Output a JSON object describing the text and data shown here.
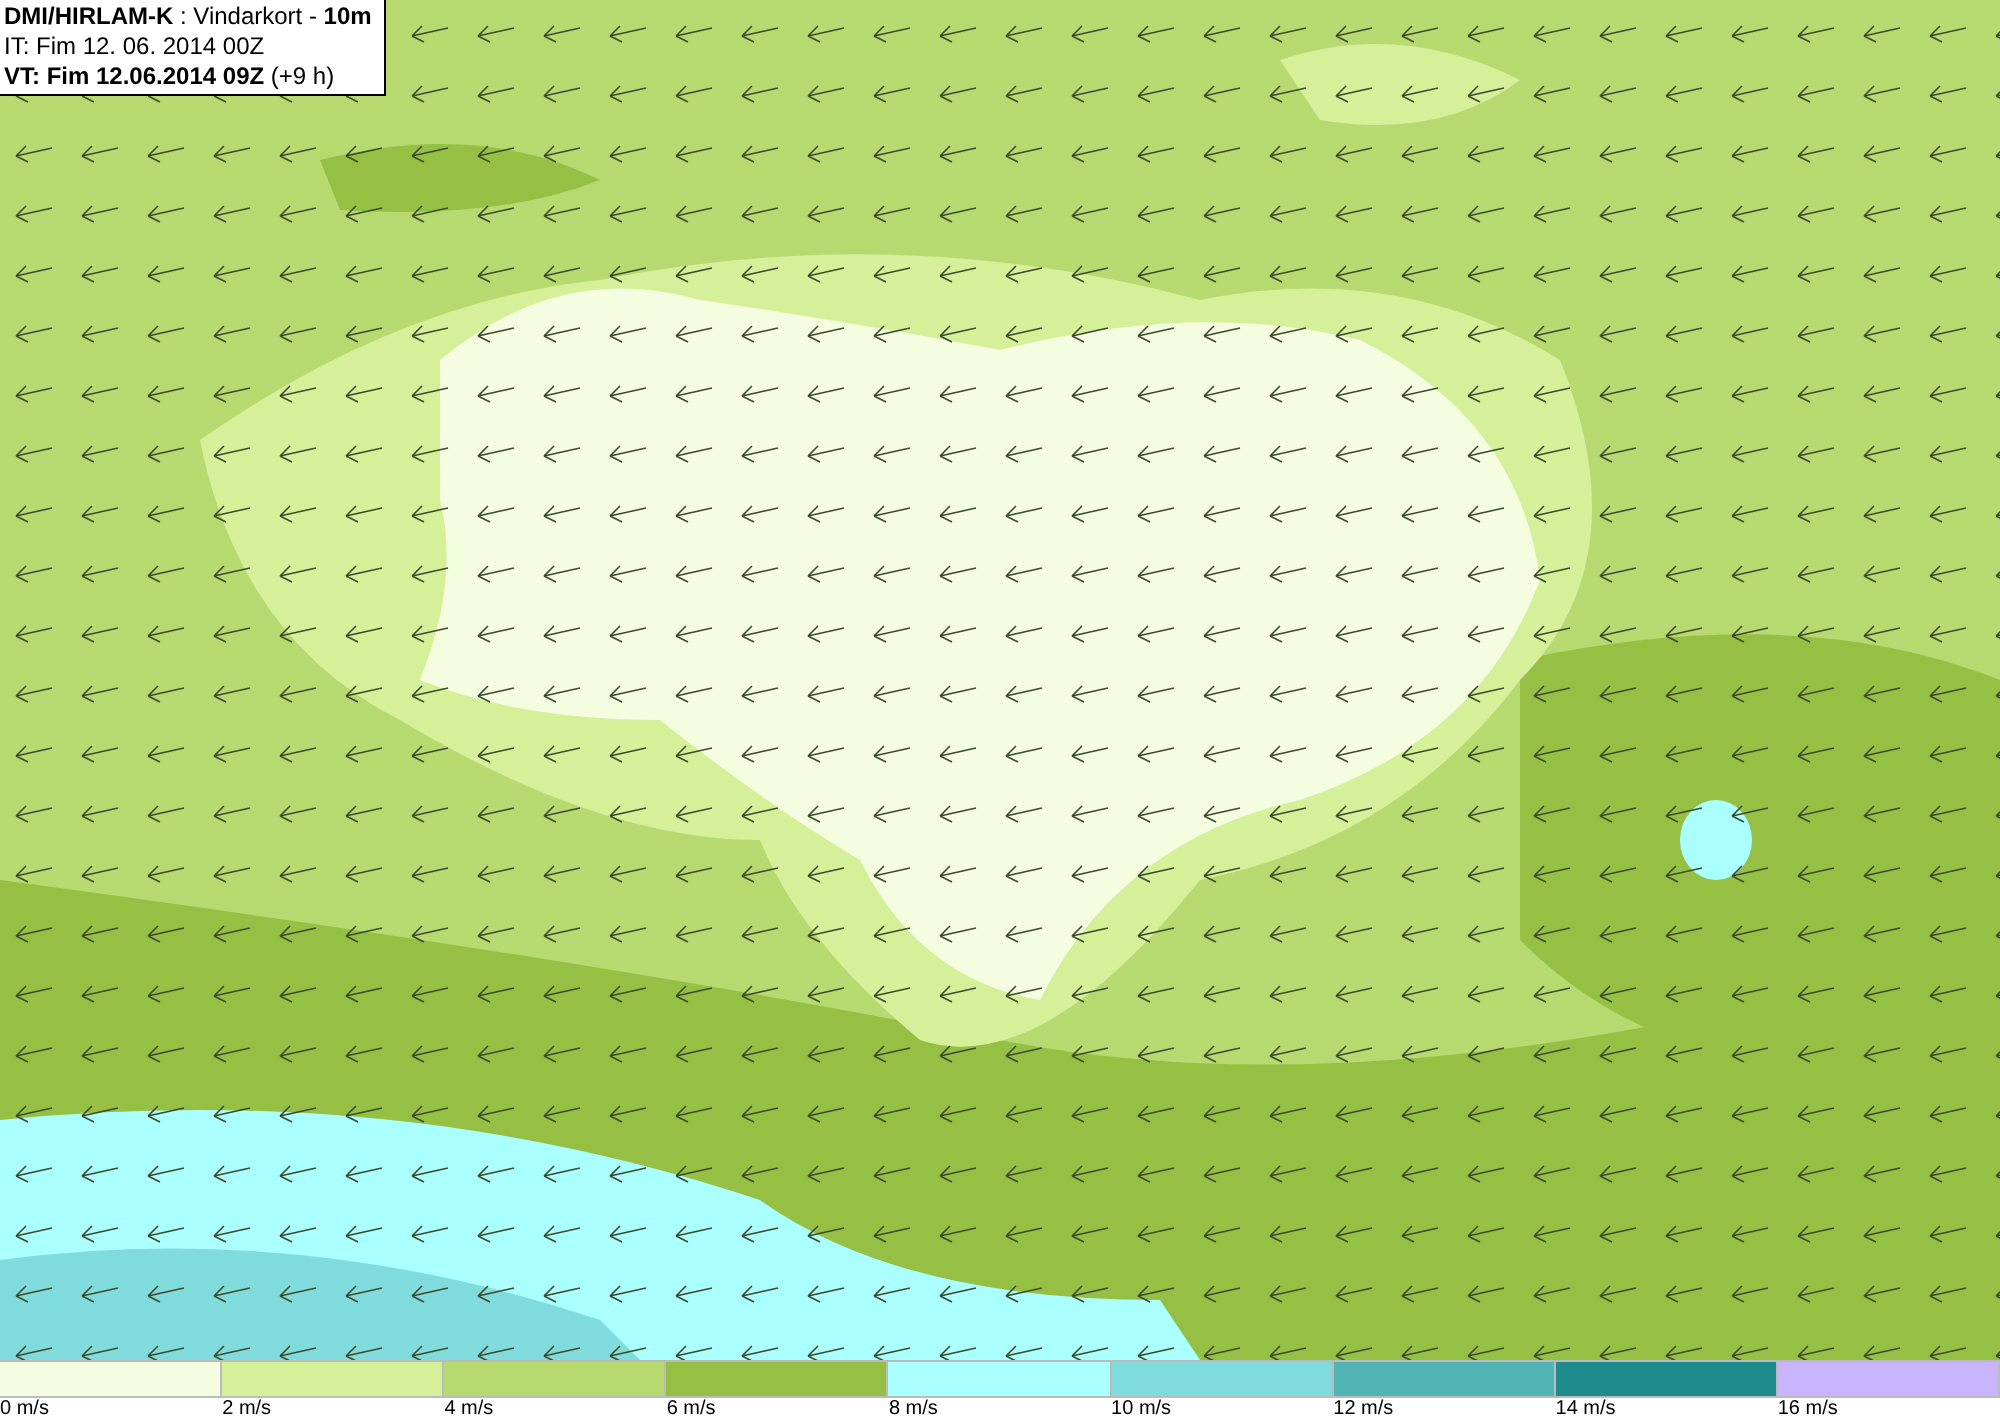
{
  "header": {
    "lines": [
      "**DMI/HIRLAM-K** : Vindarkort - **10m**",
      "IT: Fim 12. 06. 2014 00Z",
      "**VT: Fim 12.06.2014 09Z** (+9 h)"
    ]
  },
  "legend": [
    {
      "label": "0 m/s",
      "color": "#f4fde0"
    },
    {
      "label": "2 m/s",
      "color": "#d6f09a"
    },
    {
      "label": "4 m/s",
      "color": "#b6da70"
    },
    {
      "label": "6 m/s",
      "color": "#95c043"
    },
    {
      "label": "8 m/s",
      "color": "#aaffff"
    },
    {
      "label": "10 m/s",
      "color": "#80dcdc"
    },
    {
      "label": "12 m/s",
      "color": "#50b4b4"
    },
    {
      "label": "14 m/s",
      "color": "#1e8c8c"
    },
    {
      "label": "16 m/s",
      "color": "#c8b4ff"
    }
  ]
}
